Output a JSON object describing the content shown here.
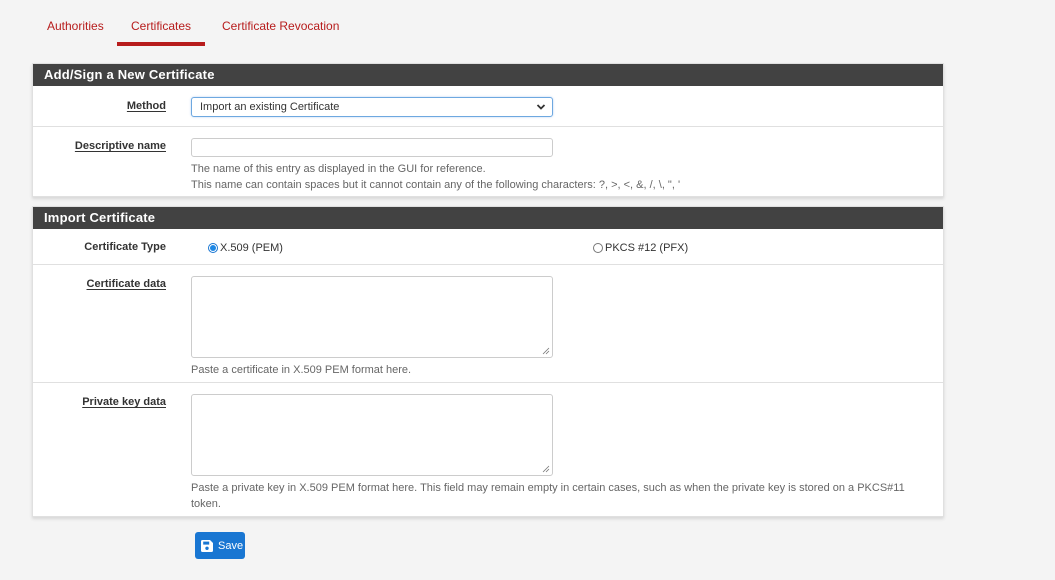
{
  "tabs": [
    {
      "label": "Authorities",
      "active": false
    },
    {
      "label": "Certificates",
      "active": true
    },
    {
      "label": "Certificate Revocation",
      "active": false
    }
  ],
  "colors": {
    "accent_red": "#b71c1c",
    "panel_heading_bg": "#424242",
    "primary_blue": "#1976d2"
  },
  "add_panel": {
    "title": "Add/Sign a New Certificate",
    "method": {
      "label": "Method",
      "selected": "Import an existing Certificate",
      "icon": "chevron-down-icon"
    },
    "descriptive_name": {
      "label": "Descriptive name",
      "value": "",
      "help_line1": "The name of this entry as displayed in the GUI for reference.",
      "help_line2": "This name can contain spaces but it cannot contain any of the following characters: ?, >, <, &, /, \\, \", '"
    }
  },
  "import_panel": {
    "title": "Import Certificate",
    "certificate_type": {
      "label": "Certificate Type",
      "options": [
        {
          "label": "X.509 (PEM)",
          "checked": true
        },
        {
          "label": "PKCS #12 (PFX)",
          "checked": false
        }
      ]
    },
    "certificate_data": {
      "label": "Certificate data",
      "value": "",
      "help": "Paste a certificate in X.509 PEM format here."
    },
    "private_key_data": {
      "label": "Private key data",
      "value": "",
      "help": "Paste a private key in X.509 PEM format here. This field may remain empty in certain cases, such as when the private key is stored on a PKCS#11 token."
    }
  },
  "save_button": {
    "label": "Save",
    "icon": "save-icon"
  }
}
